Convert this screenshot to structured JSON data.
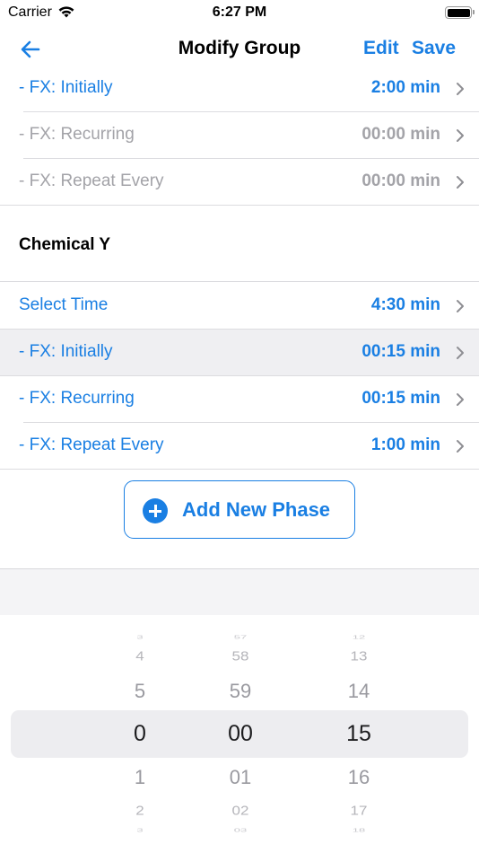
{
  "status_bar": {
    "carrier": "Carrier",
    "time": "6:27 PM",
    "battery_level": 1.0
  },
  "nav": {
    "back_icon": "arrow-left-icon",
    "title": "Modify Group",
    "edit_label": "Edit",
    "save_label": "Save"
  },
  "rows_top": [
    {
      "label": "- FX: Initially",
      "value": "2:00 min",
      "style": "blue"
    },
    {
      "label": "- FX: Recurring",
      "value": "00:00 min",
      "style": "gray"
    },
    {
      "label": "- FX: Repeat Every",
      "value": "00:00 min",
      "style": "gray"
    }
  ],
  "section": {
    "title": "Chemical Y"
  },
  "rows_bottom": [
    {
      "label": "Select Time",
      "value": "4:30 min",
      "style": "blue"
    },
    {
      "label": "- FX: Initially",
      "value": "00:15 min",
      "style": "blue",
      "selected": true
    },
    {
      "label": "- FX: Recurring",
      "value": "00:15 min",
      "style": "blue"
    },
    {
      "label": "- FX: Repeat Every",
      "value": "1:00 min",
      "style": "blue"
    }
  ],
  "add_phase": {
    "icon": "plus-circle-icon",
    "label": "Add New Phase"
  },
  "picker": {
    "hours": {
      "far_top": "3",
      "near_top": "4",
      "close_top": "5",
      "selected": "0",
      "close_bottom": "1",
      "near_bottom": "2",
      "far_bottom": "3"
    },
    "minutes": {
      "far_top": "57",
      "near_top": "58",
      "close_top": "59",
      "selected": "00",
      "close_bottom": "01",
      "near_bottom": "02",
      "far_bottom": "03"
    },
    "seconds": {
      "far_top": "12",
      "near_top": "13",
      "close_top": "14",
      "selected": "15",
      "close_bottom": "16",
      "near_bottom": "17",
      "far_bottom": "18"
    }
  },
  "colors": {
    "accent": "#1a7fe3",
    "disabled_text": "#a3a3a8",
    "selected_row_bg": "#efeff2"
  }
}
